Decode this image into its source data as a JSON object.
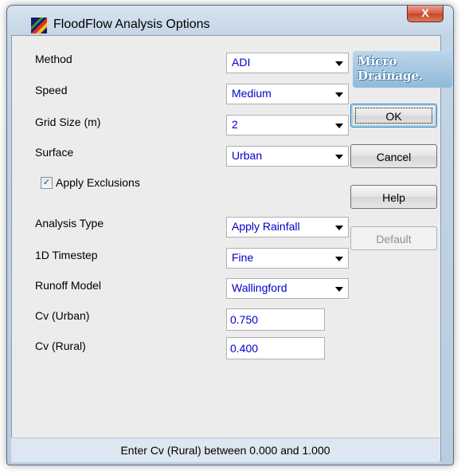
{
  "window": {
    "title": "FloodFlow Analysis Options",
    "close_label": "X"
  },
  "fields": {
    "method": {
      "label": "Method",
      "value": "ADI"
    },
    "speed": {
      "label": "Speed",
      "value": "Medium"
    },
    "grid_size": {
      "label": "Grid Size (m)",
      "value": "2"
    },
    "surface": {
      "label": "Surface",
      "value": "Urban"
    },
    "apply_exclusions": {
      "label": "Apply Exclusions",
      "checked": true,
      "check_glyph": "✓"
    },
    "analysis_type": {
      "label": "Analysis Type",
      "value": "Apply Rainfall"
    },
    "timestep_1d": {
      "label": "1D Timestep",
      "value": "Fine"
    },
    "runoff_model": {
      "label": "Runoff Model",
      "value": "Wallingford"
    },
    "cv_urban": {
      "label": "Cv (Urban)",
      "value": "0.750"
    },
    "cv_rural": {
      "label": "Cv (Rural)",
      "value": "0.400"
    }
  },
  "buttons": {
    "ok": "OK",
    "cancel": "Cancel",
    "help": "Help",
    "default": "Default"
  },
  "logo": {
    "line1": "Micro",
    "line2": "Drainage."
  },
  "status": "Enter Cv (Rural) between 0.000 and 1.000"
}
